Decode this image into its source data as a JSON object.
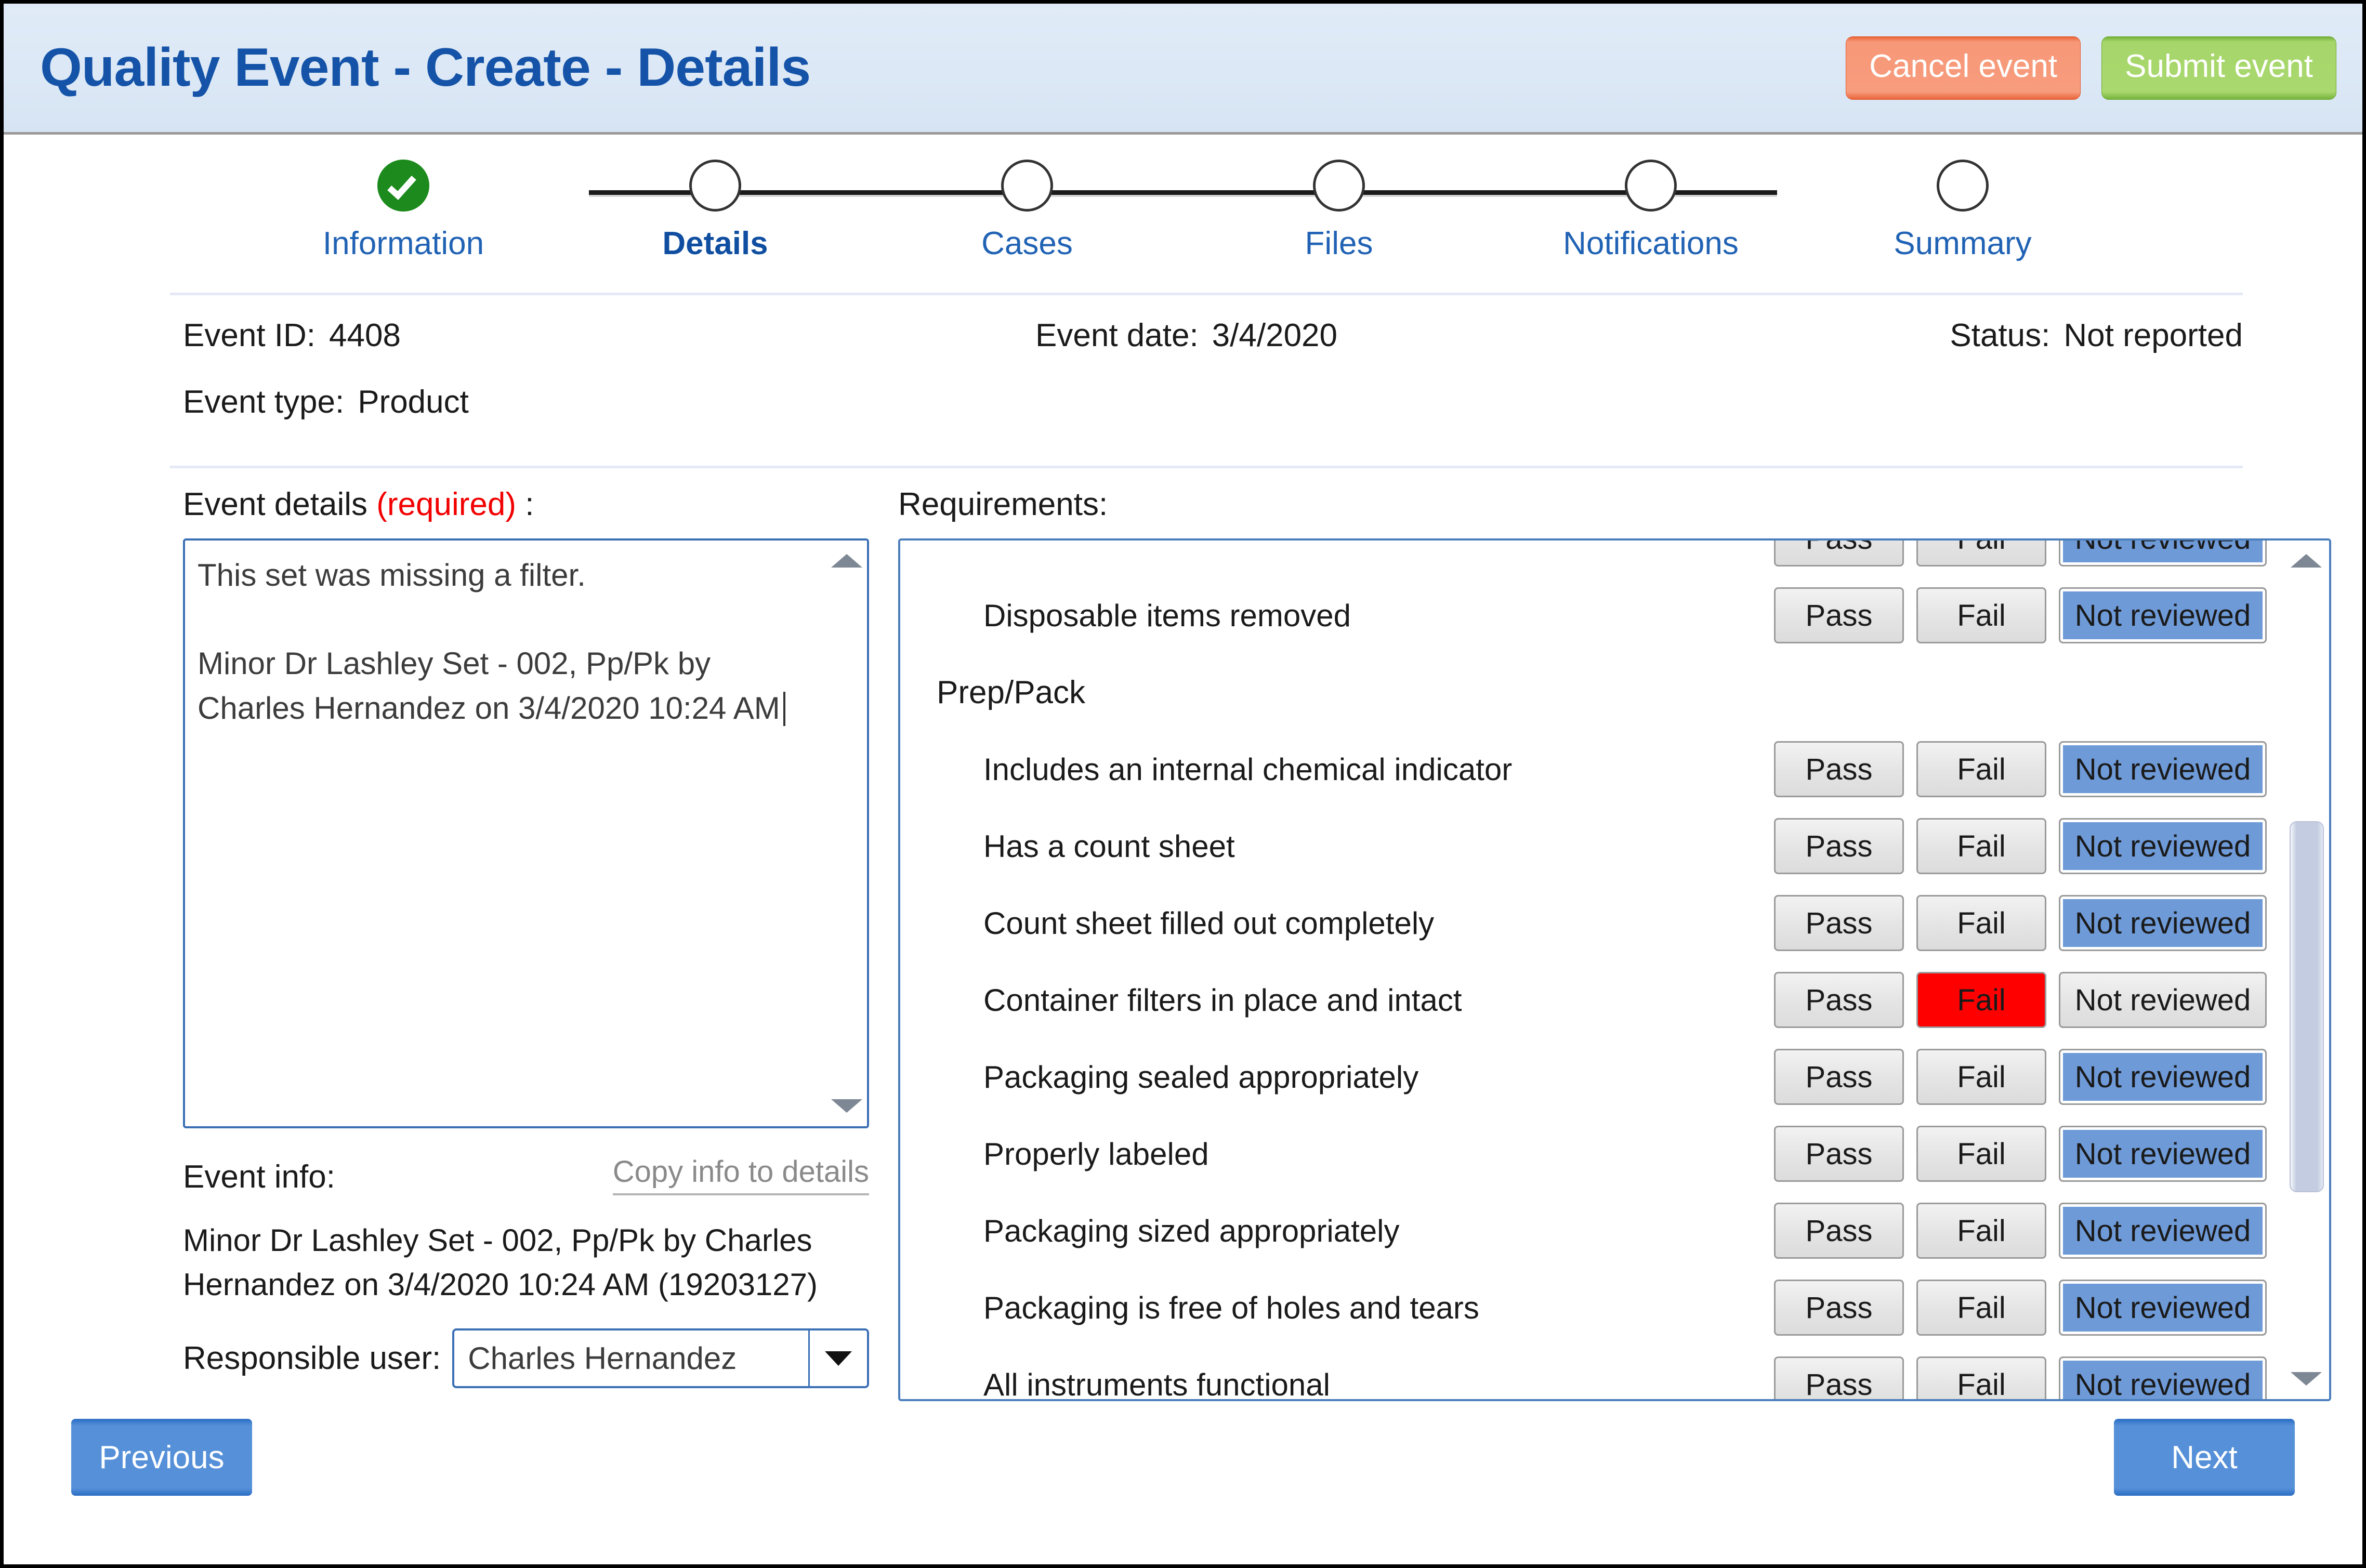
{
  "header": {
    "title": "Quality Event - Create - Details",
    "cancel_label": "Cancel event",
    "submit_label": "Submit event"
  },
  "stepper": {
    "steps": [
      {
        "label": "Information",
        "state": "done"
      },
      {
        "label": "Details",
        "state": "current"
      },
      {
        "label": "Cases",
        "state": "pending"
      },
      {
        "label": "Files",
        "state": "pending"
      },
      {
        "label": "Notifications",
        "state": "pending"
      },
      {
        "label": "Summary",
        "state": "pending"
      }
    ]
  },
  "meta": {
    "event_id_label": "Event ID:",
    "event_id_value": "4408",
    "event_date_label": "Event date:",
    "event_date_value": "3/4/2020",
    "status_label": "Status:",
    "status_value": "Not reported",
    "event_type_label": "Event type:",
    "event_type_value": "Product"
  },
  "details": {
    "label": "Event details ",
    "required_text": "(required)",
    "label_suffix": " :",
    "textarea_value": "This set was missing a filter.\n\nMinor Dr Lashley Set - 002, Pp/Pk by\nCharles Hernandez on 3/4/2020 10:24 AM",
    "info_label": "Event info:",
    "copy_link_label": "Copy info to details",
    "info_text": "Minor Dr Lashley Set - 002, Pp/Pk by Charles Hernandez on 3/4/2020 10:24 AM (19203127)",
    "responsible_label": "Responsible user:",
    "responsible_value": "Charles Hernandez"
  },
  "requirements": {
    "label": "Requirements:",
    "button_labels": {
      "pass": "Pass",
      "fail": "Fail",
      "not_reviewed": "Not reviewed"
    },
    "rows": [
      {
        "type": "item",
        "name": "",
        "state": "not_reviewed",
        "partial": true
      },
      {
        "type": "item",
        "name": "Disposable items removed",
        "state": "not_reviewed"
      },
      {
        "type": "group",
        "name": "Prep/Pack"
      },
      {
        "type": "item",
        "name": "Includes an internal chemical indicator",
        "state": "not_reviewed"
      },
      {
        "type": "item",
        "name": "Has a count sheet",
        "state": "not_reviewed"
      },
      {
        "type": "item",
        "name": "Count sheet filled out completely",
        "state": "not_reviewed"
      },
      {
        "type": "item",
        "name": "Container filters in place and intact",
        "state": "fail"
      },
      {
        "type": "item",
        "name": "Packaging sealed appropriately",
        "state": "not_reviewed"
      },
      {
        "type": "item",
        "name": "Properly labeled",
        "state": "not_reviewed"
      },
      {
        "type": "item",
        "name": "Packaging sized appropriately",
        "state": "not_reviewed"
      },
      {
        "type": "item",
        "name": "Packaging is free of holes and tears",
        "state": "not_reviewed"
      },
      {
        "type": "item",
        "name": "All instruments functional",
        "state": "not_reviewed"
      }
    ]
  },
  "footer": {
    "previous_label": "Previous",
    "next_label": "Next"
  },
  "colors": {
    "title_blue": "#1453a8",
    "header_bg": "#dce8f6",
    "cancel_orange": "#f79c7d",
    "submit_green": "#a9d86e",
    "step_done_green": "#1c8a1c",
    "step_label_blue": "#2062b4",
    "required_red": "#f20000",
    "selected_blue": "#6e9ad8",
    "fail_red": "#ff0000",
    "nav_blue": "#5590d8",
    "field_border_blue": "#3b6fb5"
  }
}
